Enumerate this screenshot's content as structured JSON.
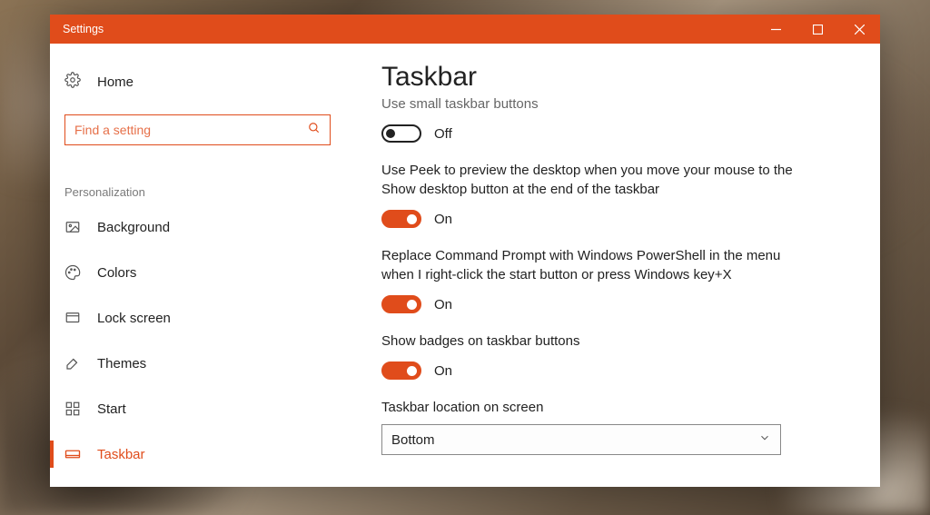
{
  "window": {
    "title": "Settings"
  },
  "sidebar": {
    "home_label": "Home",
    "search_placeholder": "Find a setting",
    "section_label": "Personalization",
    "items": [
      {
        "label": "Background"
      },
      {
        "label": "Colors"
      },
      {
        "label": "Lock screen"
      },
      {
        "label": "Themes"
      },
      {
        "label": "Start"
      },
      {
        "label": "Taskbar"
      }
    ]
  },
  "content": {
    "title": "Taskbar",
    "opt_small_buttons": {
      "label": "Use small taskbar buttons",
      "state_label": "Off"
    },
    "opt_peek": {
      "label": "Use Peek to preview the desktop when you move your mouse to the Show desktop button at the end of the taskbar",
      "state_label": "On"
    },
    "opt_powershell": {
      "label": "Replace Command Prompt with Windows PowerShell in the menu when I right-click the start button or press Windows key+X",
      "state_label": "On"
    },
    "opt_badges": {
      "label": "Show badges on taskbar buttons",
      "state_label": "On"
    },
    "location": {
      "label": "Taskbar location on screen",
      "value": "Bottom"
    }
  }
}
